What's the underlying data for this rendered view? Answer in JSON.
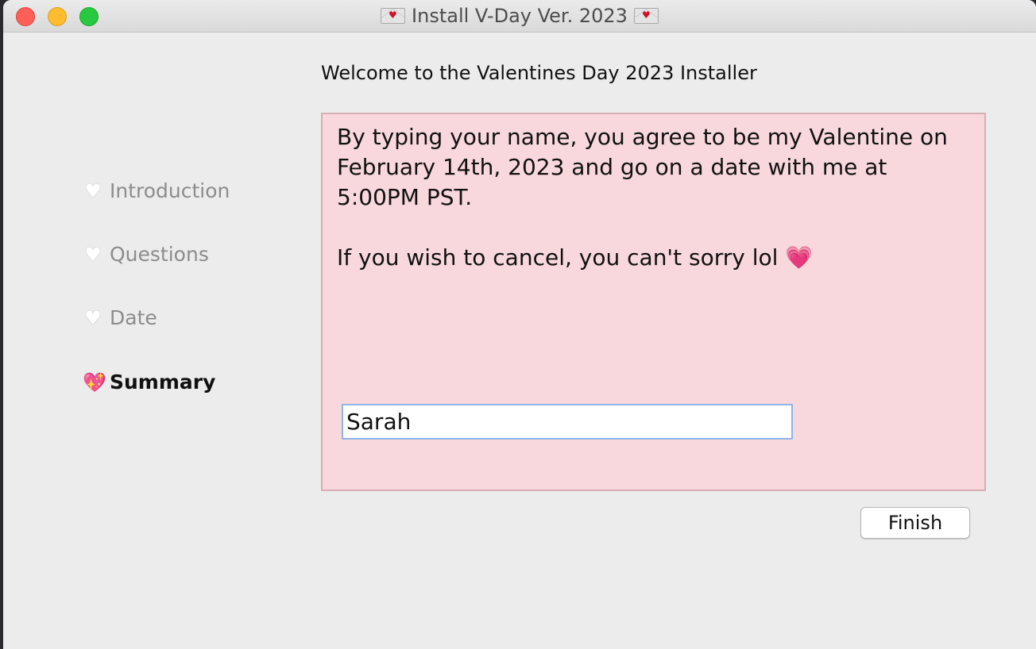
{
  "window": {
    "title": "Install V-Day Ver. 2023"
  },
  "header": {
    "welcome": "Welcome to the Valentines Day 2023 Installer"
  },
  "sidebar": {
    "items": [
      {
        "label": "Introduction",
        "icon": "white-heart-icon",
        "active": false
      },
      {
        "label": "Questions",
        "icon": "white-heart-icon",
        "active": false
      },
      {
        "label": "Date",
        "icon": "white-heart-icon",
        "active": false
      },
      {
        "label": "Summary",
        "icon": "sparkling-heart-icon",
        "active": true
      }
    ]
  },
  "main": {
    "message_line1": "By typing your name, you agree to be my Valentine on February 14th, 2023 and go on a date with me at 5:00PM PST.",
    "message_line2": "If you wish to cancel, you can't sorry lol",
    "name_input_value": "Sarah"
  },
  "footer": {
    "finish_label": "Finish"
  },
  "colors": {
    "panel_background": "#f8d8dc",
    "heart_pink": "#e8407f",
    "window_background": "#ececec"
  }
}
